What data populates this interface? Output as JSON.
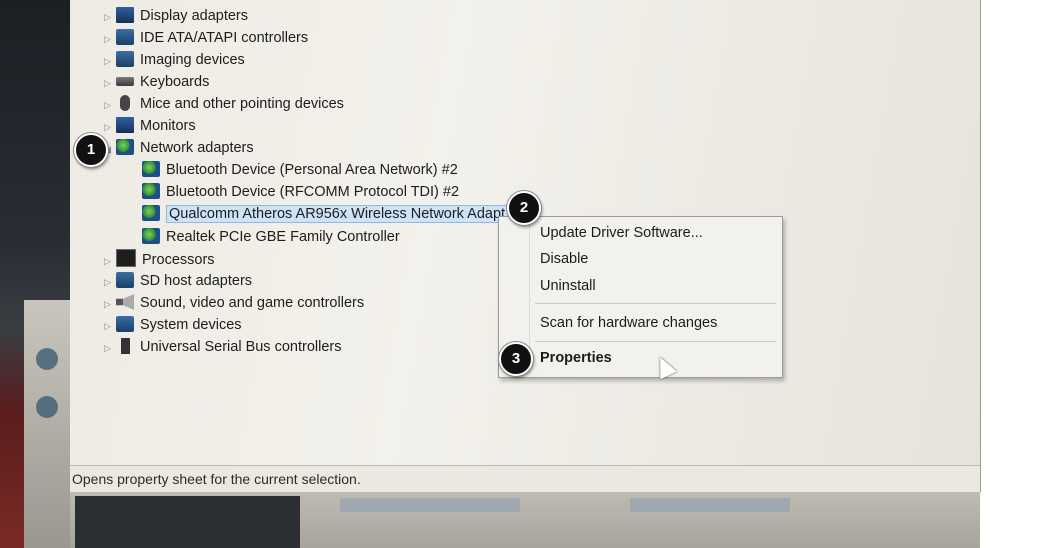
{
  "status_bar": {
    "text": "Opens property sheet for the current selection."
  },
  "tree": {
    "display_adapters": "Display adapters",
    "ide_controllers": "IDE ATA/ATAPI controllers",
    "imaging_devices": "Imaging devices",
    "keyboards": "Keyboards",
    "mice": "Mice and other pointing devices",
    "monitors": "Monitors",
    "network_adapters": "Network adapters",
    "net_child_1": "Bluetooth Device (Personal Area Network) #2",
    "net_child_2": "Bluetooth Device (RFCOMM Protocol TDI) #2",
    "net_child_3": "Qualcomm Atheros AR956x Wireless Network Adapt",
    "net_child_4": "Realtek PCIe GBE Family Controller",
    "processors": "Processors",
    "sd_host": "SD host adapters",
    "sound": "Sound, video and game controllers",
    "system_devices": "System devices",
    "usb": "Universal Serial Bus controllers"
  },
  "context_menu": {
    "update_driver": "Update Driver Software...",
    "disable": "Disable",
    "uninstall": "Uninstall",
    "scan": "Scan for hardware changes",
    "properties": "Properties"
  },
  "callouts": {
    "one": "1",
    "two": "2",
    "three": "3"
  },
  "icons": {
    "expander": "triangle-right-icon",
    "category": "device-category-icon",
    "network": "network-adapter-icon",
    "cursor": "mouse-pointer-icon"
  }
}
